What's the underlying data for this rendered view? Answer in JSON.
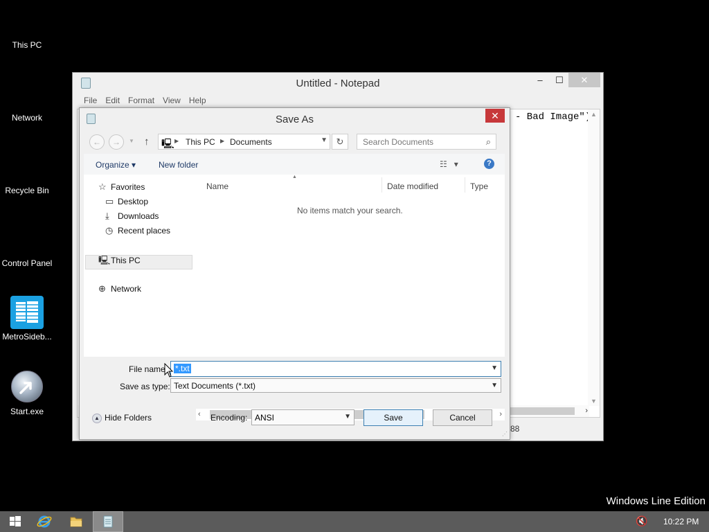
{
  "desktop": {
    "icons": [
      {
        "label": "This PC"
      },
      {
        "label": "Network"
      },
      {
        "label": "Recycle Bin"
      },
      {
        "label": "Control Panel"
      },
      {
        "label": "MetroSideb..."
      },
      {
        "label": "Start.exe"
      }
    ],
    "watermark": "Windows Line Edition"
  },
  "notepad": {
    "title": "Untitled - Notepad",
    "menu": [
      "File",
      "Edit",
      "Format",
      "View",
      "Help"
    ],
    "text_fragment": "- Bad Image\")",
    "status_fragment": "88",
    "controls": {
      "minimize": "–",
      "maximize": "☐",
      "close": "✕"
    }
  },
  "save_dialog": {
    "title": "Save As",
    "close": "✕",
    "address": {
      "segments": [
        "This PC",
        "Documents"
      ]
    },
    "search_placeholder": "Search Documents",
    "toolbar": {
      "organize": "Organize",
      "new_folder": "New folder"
    },
    "nav_tree": {
      "favorites": "Favorites",
      "items": [
        "Desktop",
        "Downloads",
        "Recent places"
      ],
      "this_pc": "This PC",
      "network": "Network"
    },
    "columns": [
      "Name",
      "Date modified",
      "Type"
    ],
    "empty_message": "No items match your search.",
    "file_name_label": "File name:",
    "file_name_value": "*.txt",
    "save_as_type_label": "Save as type:",
    "save_as_type_value": "Text Documents (*.txt)",
    "hide_folders": "Hide Folders",
    "encoding_label": "Encoding:",
    "encoding_value": "ANSI",
    "save_button": "Save",
    "cancel_button": "Cancel"
  },
  "taskbar": {
    "clock": "10:22 PM"
  },
  "colors": {
    "desktop_bg": "#000000",
    "taskbar_bg": "#5b5b5b",
    "close_red": "#c7383a",
    "selection_blue": "#3399ff",
    "metro_tile": "#1ba1e2"
  }
}
